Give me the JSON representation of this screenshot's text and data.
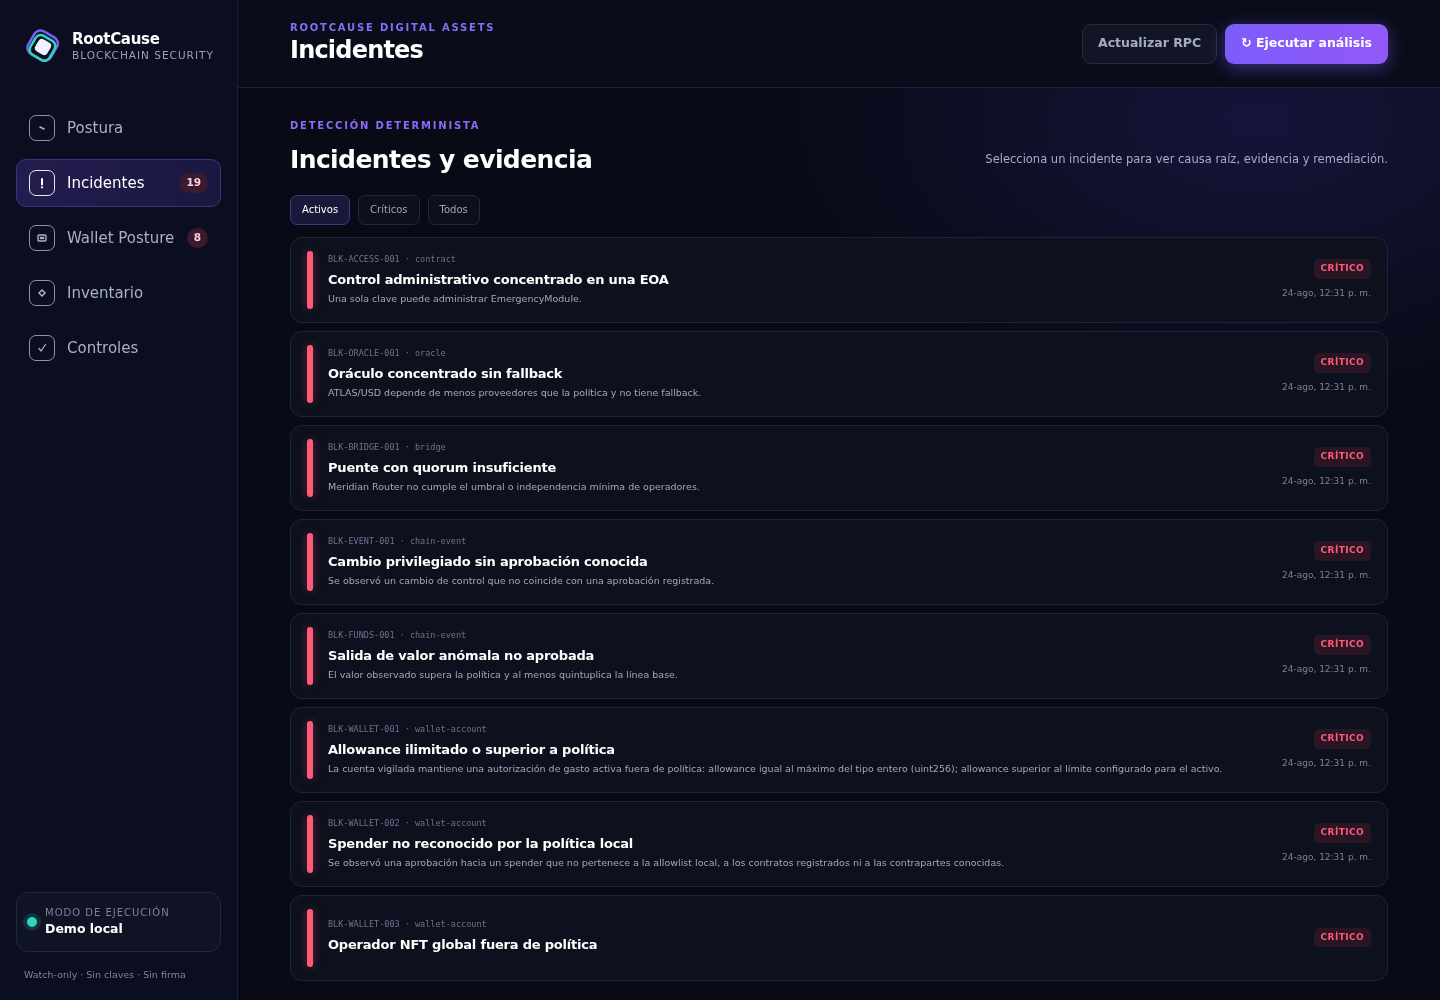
{
  "brand": {
    "name": "RootCause",
    "tagline": "BLOCKCHAIN SECURITY"
  },
  "sidebar": {
    "items": [
      {
        "label": "Postura",
        "selected": false
      },
      {
        "label": "Incidentes",
        "selected": true,
        "count": "19"
      },
      {
        "label": "Wallet Posture",
        "selected": false,
        "count": "8"
      },
      {
        "label": "Inventario",
        "selected": false
      },
      {
        "label": "Controles",
        "selected": false
      }
    ],
    "mode": {
      "label": "MODO DE EJECUCIÓN",
      "value": "Demo local",
      "color": "#2dd4bf"
    },
    "footnote": "Watch-only · Sin claves · Sin firma"
  },
  "header": {
    "eyebrow": "ROOTCAUSE DIGITAL ASSETS",
    "title": "Incidentes",
    "buttons": [
      {
        "label": "Actualizar RPC",
        "kind": "secondary"
      },
      {
        "label": "↻ Ejecutar análisis",
        "kind": "primary"
      }
    ]
  },
  "section": {
    "eyebrow": "DETECCIÓN DETERMINISTA",
    "title": "Incidentes y evidencia",
    "hint": "Selecciona un incidente para ver causa raíz, evidencia y remediación."
  },
  "tabs": [
    {
      "label": "Activos",
      "selected": true
    },
    {
      "label": "Críticos",
      "selected": false
    },
    {
      "label": "Todos",
      "selected": false
    }
  ],
  "incidents": [
    {
      "code": "BLK-ACCESS-001 · contract",
      "title": "Control administrativo concentrado en una EOA",
      "description": "Una sola clave puede administrar EmergencyModule.",
      "severity": "CRÍTICO",
      "time": "24-ago, 12:31 p. m."
    },
    {
      "code": "BLK-ORACLE-001 · oracle",
      "title": "Oráculo concentrado sin fallback",
      "description": "ATLAS/USD depende de menos proveedores que la política y no tiene fallback.",
      "severity": "CRÍTICO",
      "time": "24-ago, 12:31 p. m."
    },
    {
      "code": "BLK-BRIDGE-001 · bridge",
      "title": "Puente con quorum insuficiente",
      "description": "Meridian Router no cumple el umbral o independencia mínima de operadores.",
      "severity": "CRÍTICO",
      "time": "24-ago, 12:31 p. m."
    },
    {
      "code": "BLK-EVENT-001 · chain-event",
      "title": "Cambio privilegiado sin aprobación conocida",
      "description": "Se observó un cambio de control que no coincide con una aprobación registrada.",
      "severity": "CRÍTICO",
      "time": "24-ago, 12:31 p. m."
    },
    {
      "code": "BLK-FUNDS-001 · chain-event",
      "title": "Salida de valor anómala no aprobada",
      "description": "El valor observado supera la política y al menos quintuplica la línea base.",
      "severity": "CRÍTICO",
      "time": "24-ago, 12:31 p. m."
    },
    {
      "code": "BLK-WALLET-001 · wallet-account",
      "title": "Allowance ilimitado o superior a política",
      "description": "La cuenta vigilada mantiene una autorización de gasto activa fuera de política: allowance igual al máximo del tipo entero (uint256); allowance superior al límite configurado para el activo.",
      "severity": "CRÍTICO",
      "time": "24-ago, 12:31 p. m."
    },
    {
      "code": "BLK-WALLET-002 · wallet-account",
      "title": "Spender no reconocido por la política local",
      "description": "Se observó una aprobación hacia un spender que no pertenece a la allowlist local, a los contratos registrados ni a las contrapartes conocidas.",
      "severity": "CRÍTICO",
      "time": "24-ago, 12:31 p. m."
    },
    {
      "code": "BLK-WALLET-003 · wallet-account",
      "title": "Operador NFT global fuera de política",
      "severity": "CRÍTICO"
    }
  ]
}
